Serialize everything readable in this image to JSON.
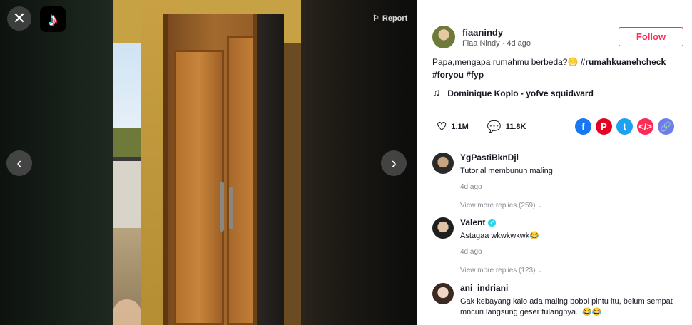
{
  "player": {
    "close_icon": "close-icon",
    "logo_icon": "tiktok-logo",
    "report_label": "Report",
    "prev_icon": "chevron-left-icon",
    "next_icon": "chevron-right-icon"
  },
  "post": {
    "username": "fiaanindy",
    "display_line": "Fiaa Nindy · 4d ago",
    "follow_label": "Follow",
    "caption_text": "Papa,mengapa rumahmu berbeda?😁 ",
    "hashtags": [
      "#rumahkuanehcheck",
      "#foryou",
      "#fyp"
    ],
    "music": "Dominique Koplo - yofve squidward",
    "likes": "1.1M",
    "comments": "11.8K",
    "share_colors": {
      "facebook": "#1877f2",
      "pinterest": "#e60023",
      "twitter": "#1da1f2",
      "embed": "#fe2c55",
      "link": "#6f7cf0"
    }
  },
  "comments": [
    {
      "user": "YgPastiBknDjl",
      "text": "Tutorial membunuh maling",
      "time": "4d ago",
      "more": "View more replies (259)",
      "verified": false
    },
    {
      "user": "Valent",
      "text": "Astagaa wkwkwkwk😂",
      "time": "4d ago",
      "more": "View more replies (123)",
      "verified": true
    },
    {
      "user": "ani_indriani",
      "text": "Gak kebayang kalo ada maling bobol pintu itu, belum sempat mncuri langsung geser tulangnya.. 😂😂",
      "time": "",
      "more": "",
      "verified": false
    }
  ]
}
